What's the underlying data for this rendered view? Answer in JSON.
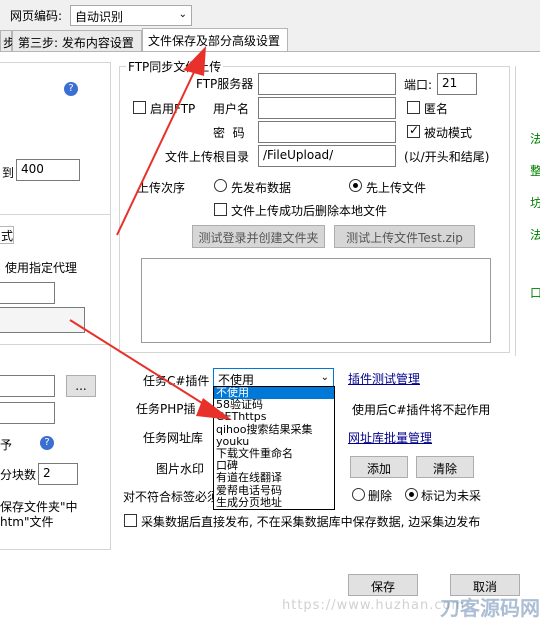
{
  "encoding": {
    "label": "网页编码:",
    "value": "自动识别"
  },
  "tabs": [
    {
      "label": "第三步: 发布内容设置"
    },
    {
      "label": "文件保存及部分高级设置"
    }
  ],
  "ftp": {
    "group_title": "FTP同步文件上传",
    "enable_label": "启用FTP",
    "server_label": "FTP服务器",
    "server_value": "",
    "port_label": "端口:",
    "port_value": "21",
    "user_label": "用户名",
    "user_value": "",
    "anon_label": "匿名",
    "password_label": "密  码",
    "password_value": "",
    "passive_label": "被动模式",
    "root_label": "文件上传根目录",
    "root_value": "/FileUpload/",
    "root_hint": "(以/开头和结尾)",
    "order_label": "上传次序",
    "order_publish_first": "先发布数据",
    "order_upload_first": "先上传文件",
    "delete_local_label": "文件上传成功后删除本地文件",
    "test_login_button": "测试登录并创建文件夹",
    "test_upload_button": "测试上传文件Test.zip"
  },
  "left": {
    "to_label": "到",
    "to_value": "400",
    "tab_fragment": "式",
    "proxy_label": "使用指定代理",
    "help_icon": "question-icon",
    "browse_label": "...",
    "partial_label": "予",
    "blocks_label": "分块数",
    "blocks_value": "2",
    "save_folder_line1": "保存文件夹\"中",
    "save_folder_line2": "htm\"文件"
  },
  "plugin": {
    "csharp_label": "任务C#插件",
    "csharp_value": "不使用",
    "csharp_link": "插件测试管理",
    "php_label": "任务PHP插",
    "php_note": "使用后C#插件将不起作用",
    "url_label": "任务网址库",
    "url_link": "网址库批量管理",
    "watermark_label": "图片水印",
    "add_button": "添加",
    "clear_button": "清除",
    "tag_rule_label": "对不符合标签必须",
    "delete_label": "删除",
    "mark_label": "标记为未采",
    "dropdown_options": [
      "不使用",
      "58验证码",
      "GEThttps",
      "qihoo搜索结果采集",
      "youku",
      "下载文件重命名",
      "口碑",
      "有道在线翻译",
      "爱帮电话号码",
      "生成分页地址"
    ],
    "selected_index": 0
  },
  "publish_direct_label": "采集数据后直接发布, 不在采集数据库中保存数据, 边采集边发布",
  "footer": {
    "save_button": "保存",
    "cancel_button": "取消"
  },
  "right_edge_fragments": [
    "法",
    "整",
    "坊",
    "法",
    "口"
  ],
  "watermark_text": "https://www.huzhan.com",
  "watermark_logo": "刀客源码网",
  "colors": {
    "arrow": "#e8312a",
    "link": "#00008b",
    "selection": "#0078d7",
    "green": "#008000"
  }
}
